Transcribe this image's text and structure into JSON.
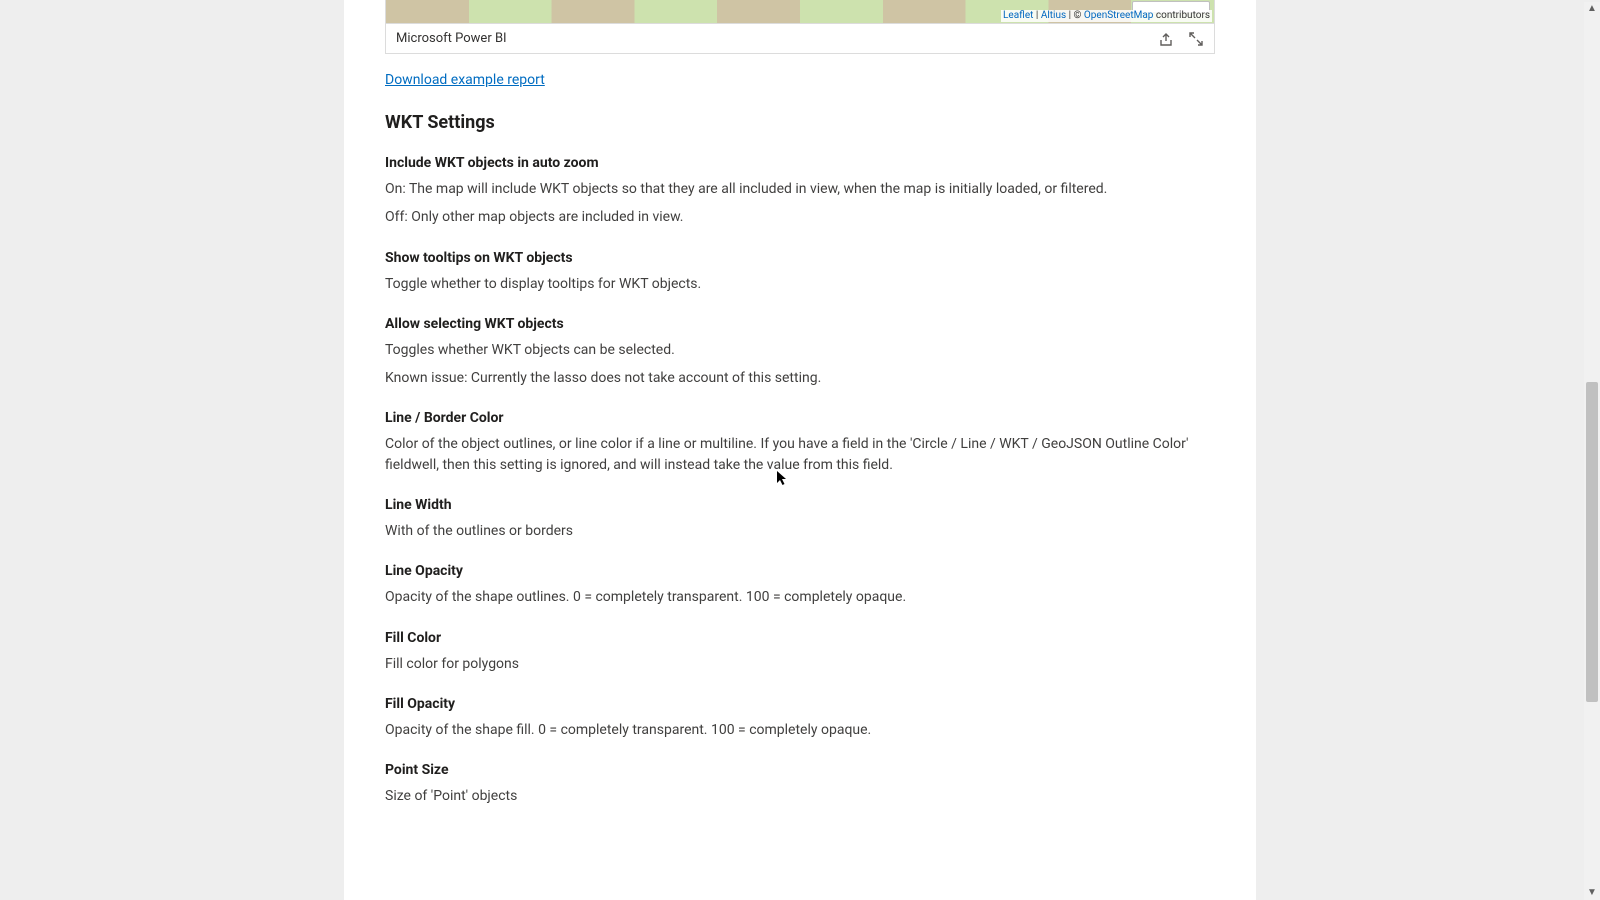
{
  "pbi": {
    "title": "Microsoft Power BI",
    "share_icon_name": "share-icon",
    "fullscreen_icon_name": "fullscreen-icon"
  },
  "map": {
    "attribution_prefix": "Leaflet",
    "attribution_sep1": " | ",
    "attribution_vendor": "Altius",
    "attribution_sep2": " | © ",
    "attribution_osm": "OpenStreetMap",
    "attribution_suffix": " contributors"
  },
  "download_link": "Download example report",
  "section_title": "WKT Settings",
  "s1": {
    "head": "Include WKT objects in auto zoom",
    "p1": "On: The map will include WKT objects so that they are all included in view, when the map is initially loaded, or filtered.",
    "p2": "Off: Only other map objects are included in view."
  },
  "s2": {
    "head": "Show tooltips on WKT objects",
    "p1": "Toggle whether to display tooltips for WKT objects."
  },
  "s3": {
    "head": "Allow selecting WKT objects",
    "p1": "Toggles whether WKT objects can be selected.",
    "p2": "Known issue: Currently the lasso does not take account of this setting."
  },
  "s4": {
    "head": "Line / Border Color",
    "p1": "Color of the object outlines, or line color if a line or multiline. If you have a field in the 'Circle / Line / WKT / GeoJSON Outline Color' fieldwell, then this setting is ignored, and will instead take the value from this field."
  },
  "s5": {
    "head": "Line Width",
    "p1": "With of the outlines or borders"
  },
  "s6": {
    "head": "Line Opacity",
    "p1": "Opacity of the shape outlines. 0 = completely transparent. 100 = completely opaque."
  },
  "s7": {
    "head": "Fill Color",
    "p1": "Fill color for polygons"
  },
  "s8": {
    "head": "Fill Opacity",
    "p1": "Opacity of the shape fill. 0 = completely transparent. 100 = completely opaque."
  },
  "s9": {
    "head": "Point Size",
    "p1": "Size of 'Point' objects"
  }
}
